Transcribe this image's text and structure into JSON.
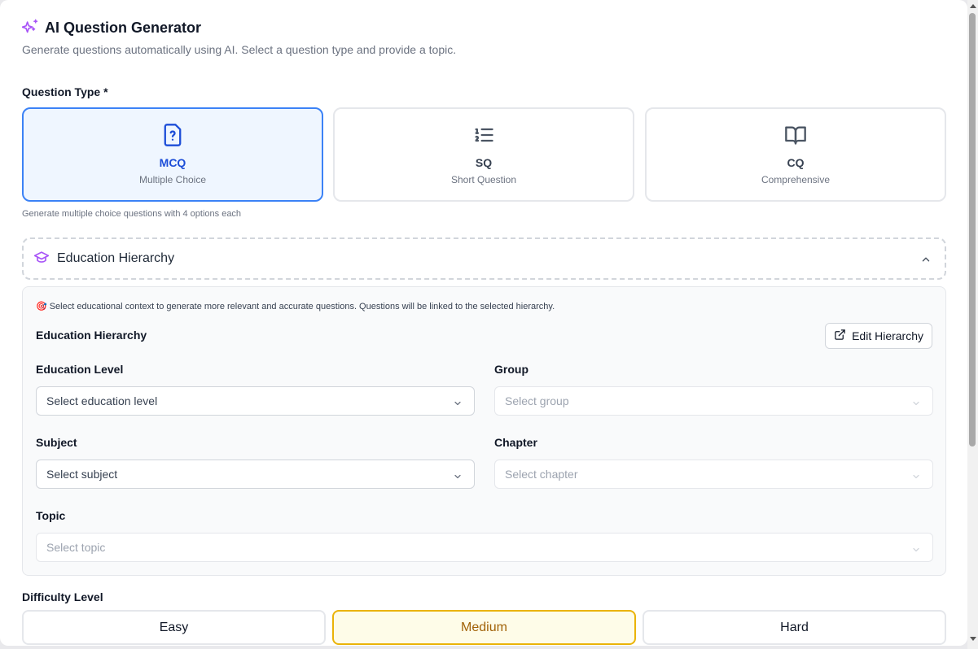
{
  "header": {
    "title": "AI Question Generator",
    "description": "Generate questions automatically using AI. Select a question type and provide a topic.",
    "icon": "sparkles-icon",
    "accent": "#a855f7"
  },
  "question_type": {
    "label": "Question Type *",
    "options": [
      {
        "code": "MCQ",
        "subtitle": "Multiple Choice",
        "icon": "file-question-icon",
        "selected": true
      },
      {
        "code": "SQ",
        "subtitle": "Short Question",
        "icon": "list-ordered-icon",
        "selected": false
      },
      {
        "code": "CQ",
        "subtitle": "Comprehensive",
        "icon": "book-open-icon",
        "selected": false
      }
    ],
    "helper": "Generate multiple choice questions with 4 options each"
  },
  "education_hierarchy": {
    "section_title": "Education Hierarchy",
    "expanded": true,
    "note": "Select educational context to generate more relevant and accurate questions. Questions will be linked to the selected hierarchy.",
    "note_icon": "🎯",
    "panel_title": "Education Hierarchy",
    "edit_button": "Edit Hierarchy",
    "fields": {
      "education_level": {
        "label": "Education Level",
        "placeholder": "Select education level",
        "disabled": false
      },
      "group": {
        "label": "Group",
        "placeholder": "Select group",
        "disabled": true
      },
      "subject": {
        "label": "Subject",
        "placeholder": "Select subject",
        "disabled": false
      },
      "chapter": {
        "label": "Chapter",
        "placeholder": "Select chapter",
        "disabled": true
      },
      "topic": {
        "label": "Topic",
        "placeholder": "Select topic",
        "disabled": true
      }
    }
  },
  "difficulty": {
    "label": "Difficulty Level",
    "options": [
      {
        "label": "Easy",
        "selected": false
      },
      {
        "label": "Medium",
        "selected": true
      },
      {
        "label": "Hard",
        "selected": false
      }
    ]
  },
  "colors": {
    "selected_blue": "#3b82f6",
    "selected_yellow": "#eab308"
  }
}
